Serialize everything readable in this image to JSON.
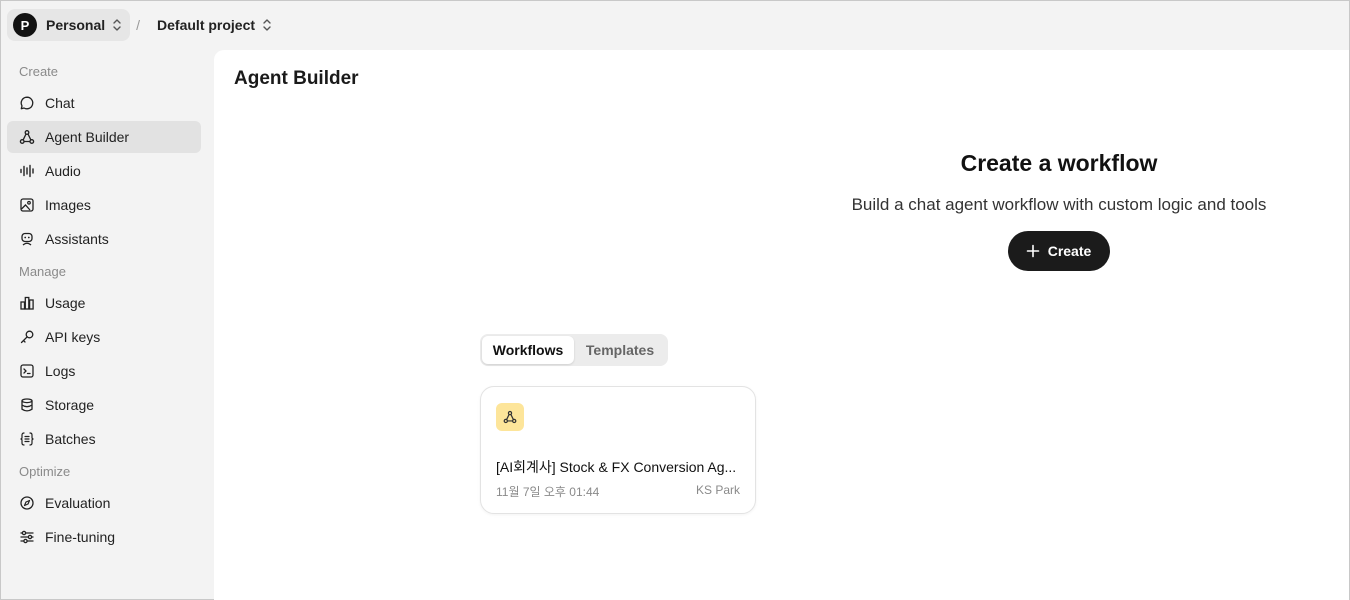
{
  "topbar": {
    "org_initial": "P",
    "org_name": "Personal",
    "separator": "/",
    "project_name": "Default project"
  },
  "sidebar": {
    "sections": [
      {
        "label": "Create"
      },
      {
        "label": "Manage"
      },
      {
        "label": "Optimize"
      }
    ],
    "items": [
      {
        "label": "Chat",
        "icon": "chat-icon"
      },
      {
        "label": "Agent Builder",
        "icon": "agent-builder-icon",
        "active": true
      },
      {
        "label": "Audio",
        "icon": "audio-icon"
      },
      {
        "label": "Images",
        "icon": "images-icon"
      },
      {
        "label": "Assistants",
        "icon": "assistants-icon"
      },
      {
        "label": "Usage",
        "icon": "usage-icon"
      },
      {
        "label": "API keys",
        "icon": "key-icon"
      },
      {
        "label": "Logs",
        "icon": "logs-icon"
      },
      {
        "label": "Storage",
        "icon": "storage-icon"
      },
      {
        "label": "Batches",
        "icon": "batches-icon"
      },
      {
        "label": "Evaluation",
        "icon": "evaluation-icon"
      },
      {
        "label": "Fine-tuning",
        "icon": "fine-tuning-icon"
      }
    ]
  },
  "main": {
    "title": "Agent Builder",
    "hero": {
      "title": "Create a workflow",
      "subtitle": "Build a chat agent workflow with custom logic and tools",
      "create_label": "Create"
    },
    "tabs": [
      {
        "label": "Workflows",
        "active": true
      },
      {
        "label": "Templates",
        "active": false
      }
    ],
    "workflows": [
      {
        "title": "[AI회계사] Stock & FX Conversion Ag...",
        "date": "11월 7일 오후 01:44",
        "author": "KS Park",
        "icon": "workflow-icon"
      }
    ]
  },
  "colors": {
    "sidebar_bg": "#f3f3f3",
    "active_item_bg": "#e2e2e2",
    "button_bg": "#1b1b1b",
    "card_icon_bg": "#fde59a"
  }
}
